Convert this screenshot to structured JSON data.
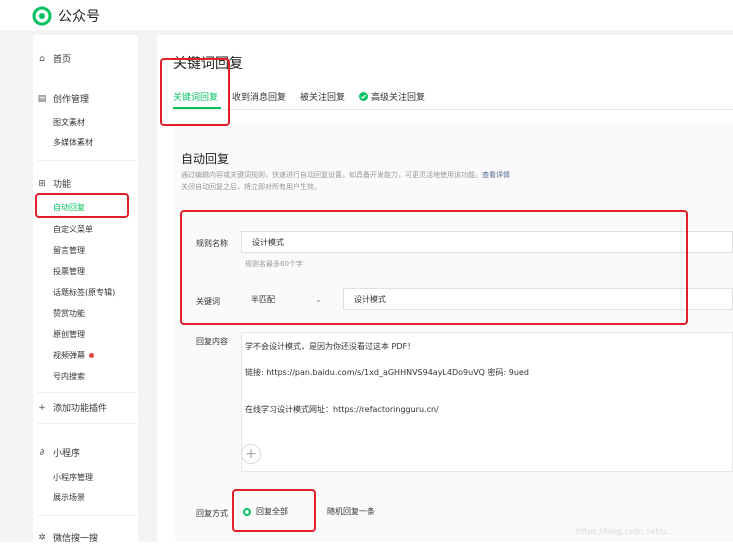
{
  "app": {
    "name": "公众号",
    "brand_color": "#07c160"
  },
  "sidebar": {
    "home": "首页",
    "create_mgmt": "创作管理",
    "create_items": [
      "图文素材",
      "多媒体素材"
    ],
    "features": "功能",
    "feature_items": [
      "自动回复",
      "自定义菜单",
      "留言管理",
      "投票管理",
      "话题标签(原专辑)",
      "赞赏功能",
      "原创管理",
      "视频弹幕",
      "号内搜索"
    ],
    "add_plugin": "添加功能插件",
    "mini_program": "小程序",
    "mini_items": [
      "小程序管理",
      "展示场景"
    ],
    "wechat_search": "微信搜一搜"
  },
  "main": {
    "title": "关键词回复",
    "tabs": [
      "关键词回复",
      "收到消息回复",
      "被关注回复",
      "高级关注回复"
    ],
    "section_title": "自动回复",
    "desc_line1": "通过编辑内容或关键词规则，快速进行自动回复设置。如具备开发能力，可更灵活地使用该功能。",
    "desc_link": "查看详情",
    "desc_line2": "关闭自动回复之后，将立即对所有用户生效。",
    "rule_name_label": "规则名称",
    "rule_name_value": "设计模式",
    "rule_name_hint": "规则名最多60个字",
    "keyword_label": "关键词",
    "match_mode": "半匹配",
    "keyword_value": "设计模式",
    "reply_content_label": "回复内容",
    "reply_lines": [
      "学不会设计模式，是因为你还没看过这本 PDF！",
      "链接: https://pan.baidu.com/s/1xd_aGHHNVS94ayL4Do9uVQ  密码: 9ued",
      "在线学习设计模式网址：https://refactoringguru.cn/"
    ],
    "add_symbol": "+",
    "reply_mode_label": "回复方式",
    "reply_all": "回复全部",
    "reply_random": "随机回复一条"
  },
  "watermark": "https://blog.csdn.net/u..."
}
